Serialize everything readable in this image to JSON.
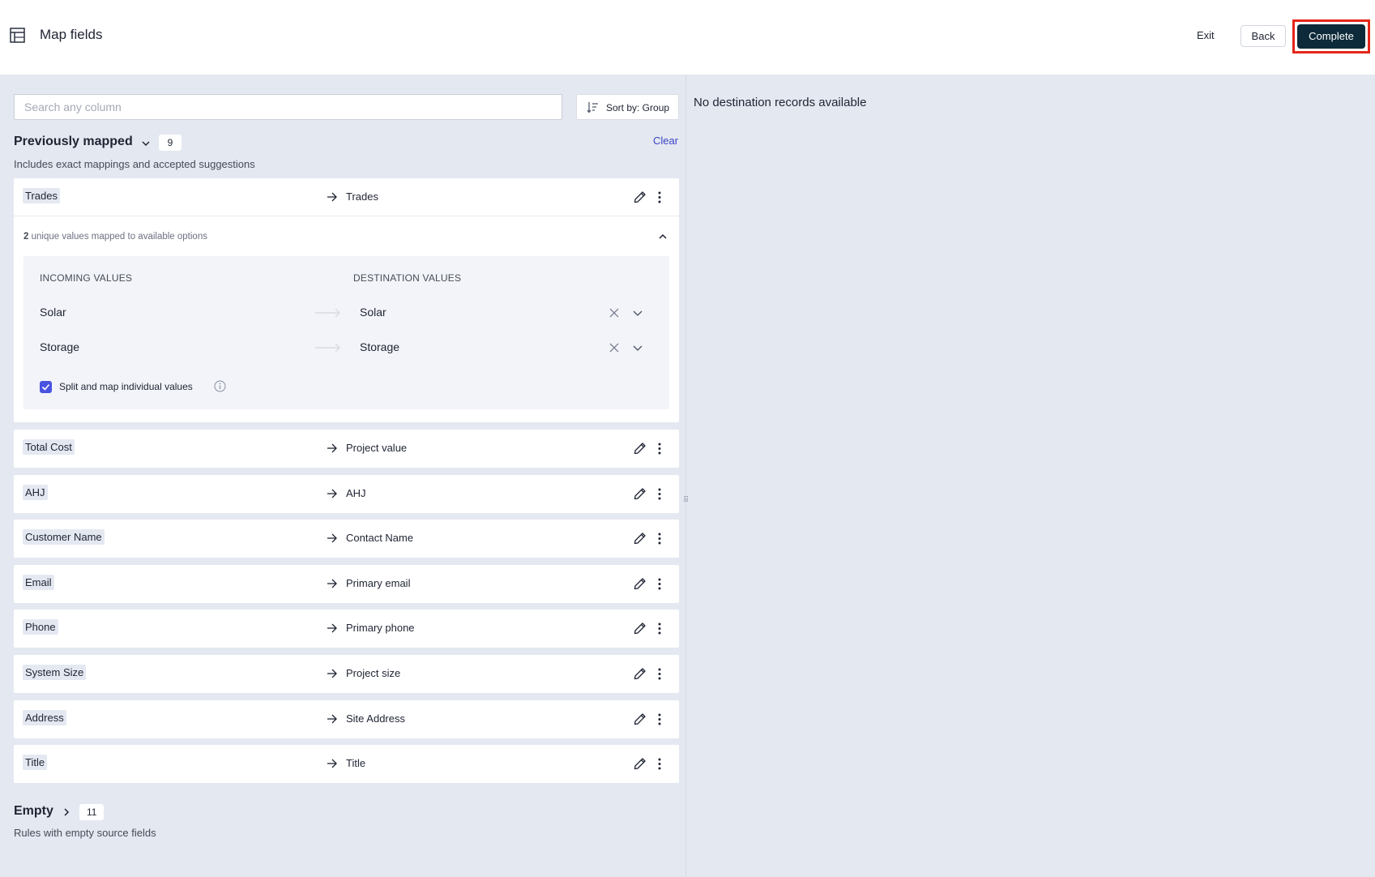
{
  "header": {
    "title": "Map fields",
    "exit_label": "Exit",
    "back_label": "Back",
    "complete_label": "Complete"
  },
  "search": {
    "placeholder": "Search any column",
    "value": ""
  },
  "sort": {
    "label": "Sort by: Group"
  },
  "previously_mapped": {
    "title": "Previously mapped",
    "count": "9",
    "description": "Includes exact mappings and accepted suggestions",
    "clear_label": "Clear"
  },
  "expanded_mapping": {
    "source": "Trades",
    "destination": "Trades",
    "unique_count": "2",
    "unique_text": " unique values mapped to available options",
    "incoming_header": "INCOMING VALUES",
    "destination_header": "DESTINATION VALUES",
    "values": [
      {
        "incoming": "Solar",
        "destination": "Solar"
      },
      {
        "incoming": "Storage",
        "destination": "Storage"
      }
    ],
    "split_label": "Split and map individual values",
    "split_checked": true
  },
  "mappings": [
    {
      "source": "Total Cost",
      "destination": "Project value"
    },
    {
      "source": "AHJ",
      "destination": "AHJ"
    },
    {
      "source": "Customer Name",
      "destination": "Contact Name"
    },
    {
      "source": "Email",
      "destination": "Primary email"
    },
    {
      "source": "Phone",
      "destination": "Primary phone"
    },
    {
      "source": "System Size",
      "destination": "Project size"
    },
    {
      "source": "Address",
      "destination": "Site Address"
    },
    {
      "source": "Title",
      "destination": "Title"
    }
  ],
  "empty_section": {
    "title": "Empty",
    "count": "11",
    "description": "Rules with empty source fields"
  },
  "right_panel": {
    "message": "No destination records available"
  },
  "colors": {
    "accent": "#3b43c4",
    "primary_button": "#0d2a3a",
    "highlight_border": "#e32619",
    "checkbox": "#4a52e0"
  },
  "icons": [
    "table-icon",
    "sort-icon",
    "chevron-down-icon",
    "chevron-up-icon",
    "arrow-right-icon",
    "pencil-icon",
    "more-vertical-icon",
    "close-icon",
    "info-icon",
    "chevron-right-icon",
    "check-icon",
    "drag-handle-icon"
  ]
}
